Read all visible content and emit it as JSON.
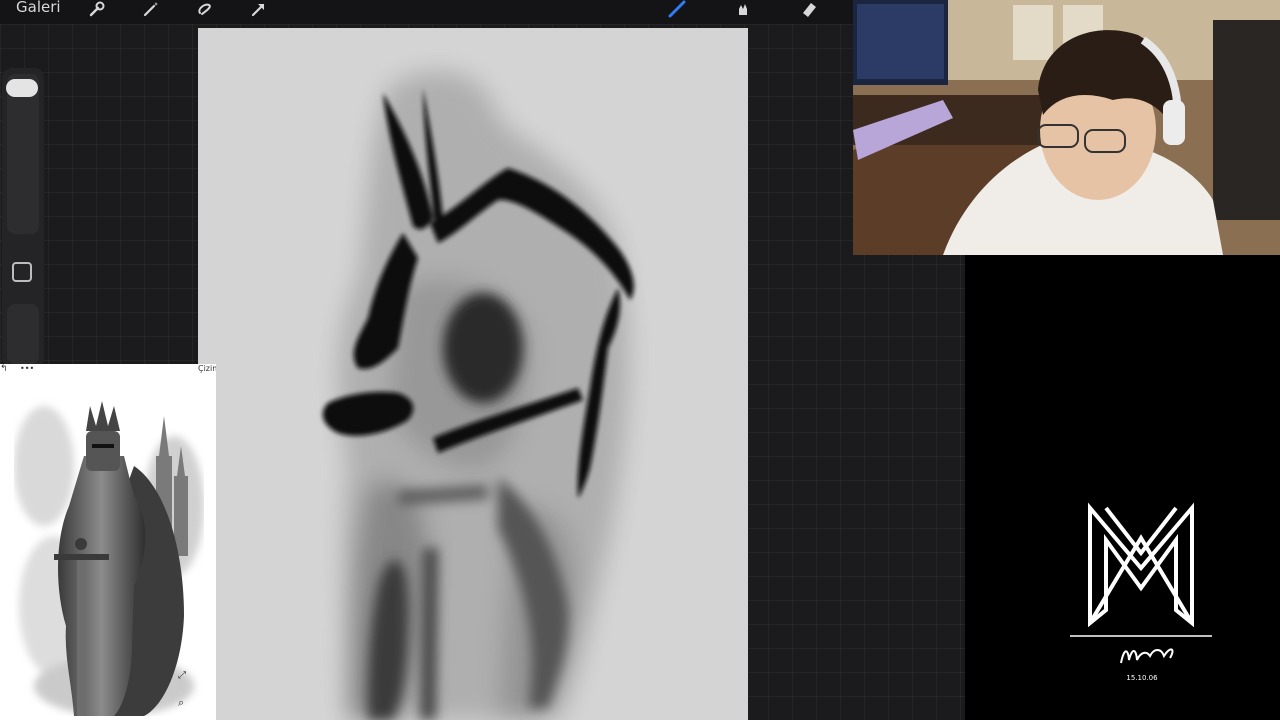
{
  "app": {
    "gallery_label": "Galeri",
    "toolbar": {
      "left_tools": [
        "wrench-icon",
        "magic-wand-icon",
        "selection-icon",
        "transform-arrow-icon"
      ],
      "right_tools": [
        "brush-icon",
        "smudge-icon",
        "eraser-icon"
      ],
      "active_color": "#2f7cf6"
    }
  },
  "reference_panel": {
    "menu_label": "•••",
    "title": "Çizim",
    "icons": [
      "close-icon",
      "expand-icon",
      "zoom-icon"
    ]
  },
  "webcam": {
    "description_icon": "webcam-feed"
  },
  "logo": {
    "monogram": "MM",
    "signature": "Murat",
    "date": "15.10.06"
  },
  "colors": {
    "app_bg": "#1b1b1d",
    "canvas_bg": "#d4d4d4",
    "stroke": "#0f0f0f"
  }
}
